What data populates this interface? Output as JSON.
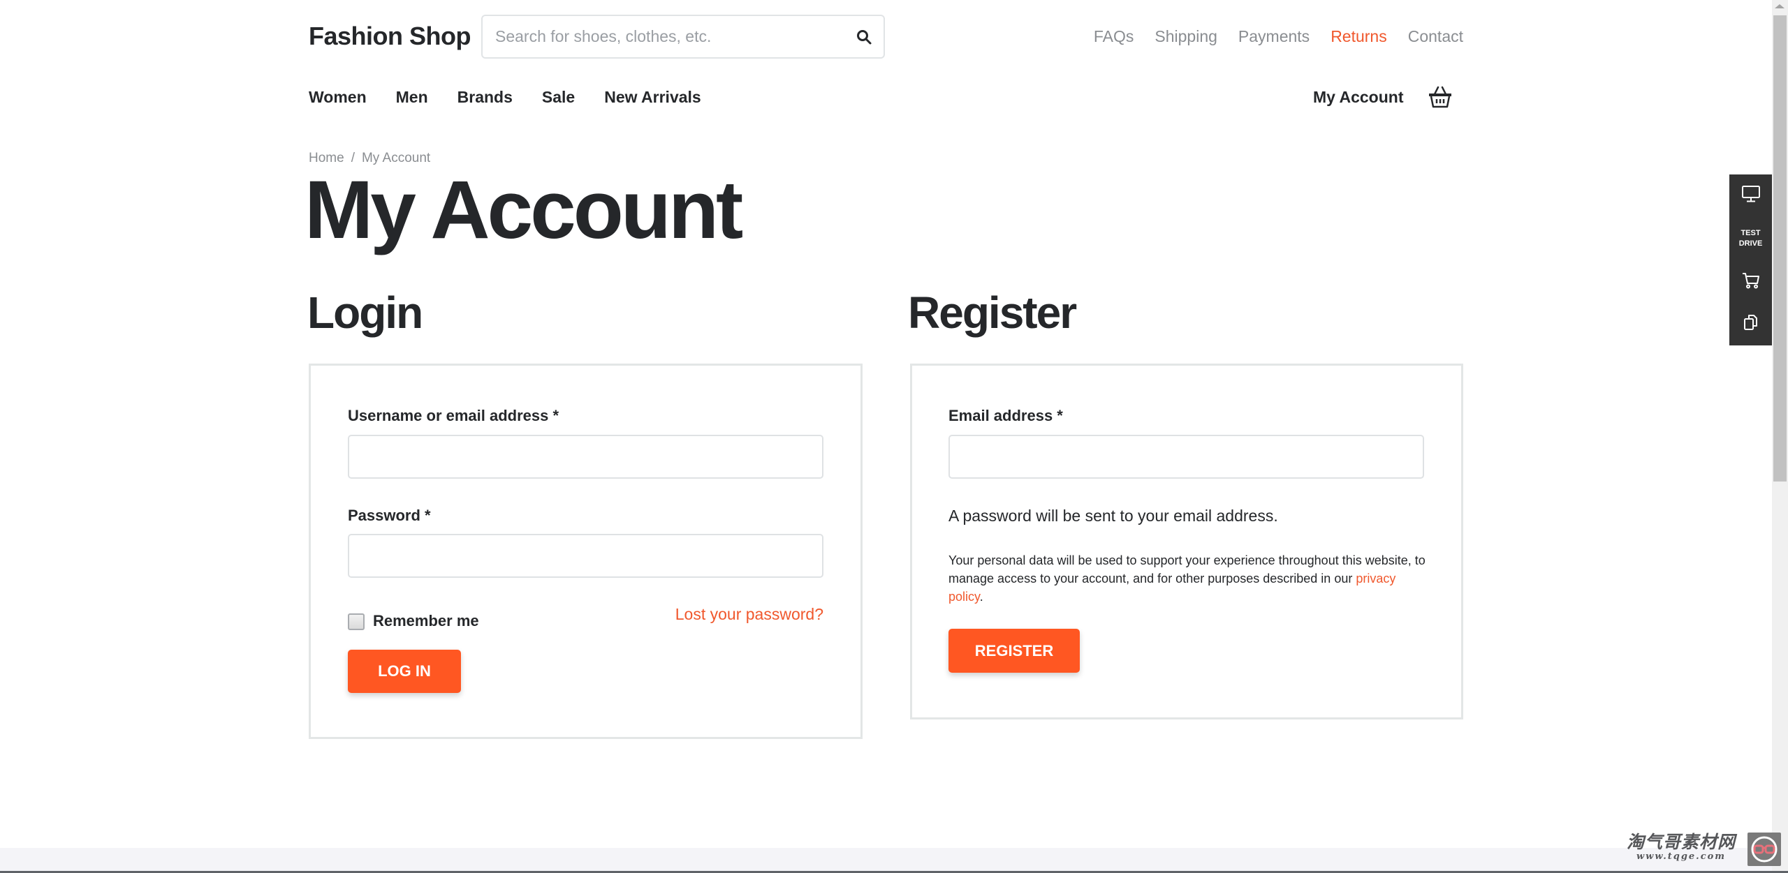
{
  "header": {
    "logo": "Fashion Shop",
    "search": {
      "placeholder": "Search for shoes, clothes, etc.",
      "value": "",
      "icon": "search-icon"
    },
    "top_links": [
      {
        "label": "FAQs",
        "active": false
      },
      {
        "label": "Shipping",
        "active": false
      },
      {
        "label": "Payments",
        "active": false
      },
      {
        "label": "Returns",
        "active": true
      },
      {
        "label": "Contact",
        "active": false
      }
    ],
    "main_nav": [
      "Women",
      "Men",
      "Brands",
      "Sale",
      "New Arrivals"
    ],
    "account_label": "My Account",
    "cart_icon": "basket-icon"
  },
  "breadcrumb": {
    "home": "Home",
    "separator": "/",
    "current": "My Account"
  },
  "page_title": "My Account",
  "login": {
    "title": "Login",
    "username_label": "Username or email address *",
    "username_value": "",
    "password_label": "Password *",
    "password_value": "",
    "remember_label": "Remember me",
    "remember_checked": false,
    "lost_password": "Lost your password?",
    "submit": "LOG IN"
  },
  "register": {
    "title": "Register",
    "email_label": "Email address *",
    "email_value": "",
    "password_note": "A password will be sent to your email address.",
    "privacy_text_before": "Your personal data will be used to support your experience throughout this website, to manage access to your account, and for other purposes described in our ",
    "privacy_link": "privacy policy",
    "privacy_text_after": ".",
    "submit": "REGISTER"
  },
  "side_panel": {
    "items": [
      {
        "icon": "monitor-icon"
      },
      {
        "label_line1": "TEST",
        "label_line2": "DRIVE"
      },
      {
        "icon": "cart-icon"
      },
      {
        "icon": "copy-icon"
      }
    ]
  },
  "watermark": {
    "title": "淘气哥素材网",
    "url": "www.tqge.com"
  },
  "colors": {
    "accent": "#ff5722",
    "link_accent": "#f0582d",
    "text": "#25272a",
    "muted": "#8a8d91",
    "border": "#e3e6e6",
    "side_panel": "#333333",
    "footer": "#f4f4f8"
  }
}
